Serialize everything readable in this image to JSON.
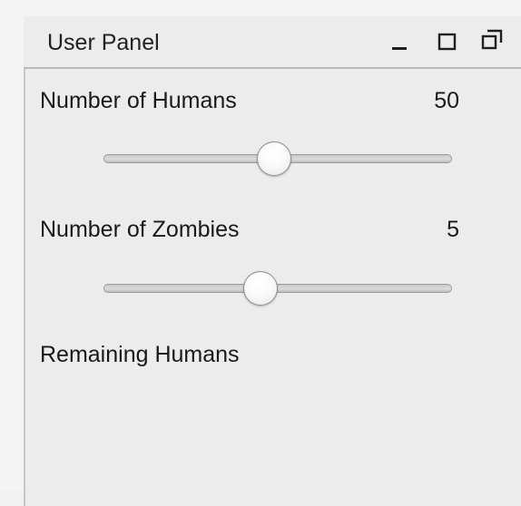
{
  "window": {
    "title": "User Panel",
    "controls": [
      {
        "name": "minimize",
        "icon": "minimize-icon"
      },
      {
        "name": "maximize",
        "icon": "maximize-icon"
      },
      {
        "name": "restore",
        "icon": "restore-icon"
      }
    ]
  },
  "humans": {
    "label": "Number of Humans",
    "value": "50",
    "slider_position": 0.49
  },
  "zombies": {
    "label": "Number of Zombies",
    "value": "5",
    "slider_position": 0.45
  },
  "remaining": {
    "label": "Remaining Humans"
  },
  "colors": {
    "background": "#ececec",
    "border": "#b9b9b9",
    "text": "#1a1a1a"
  }
}
